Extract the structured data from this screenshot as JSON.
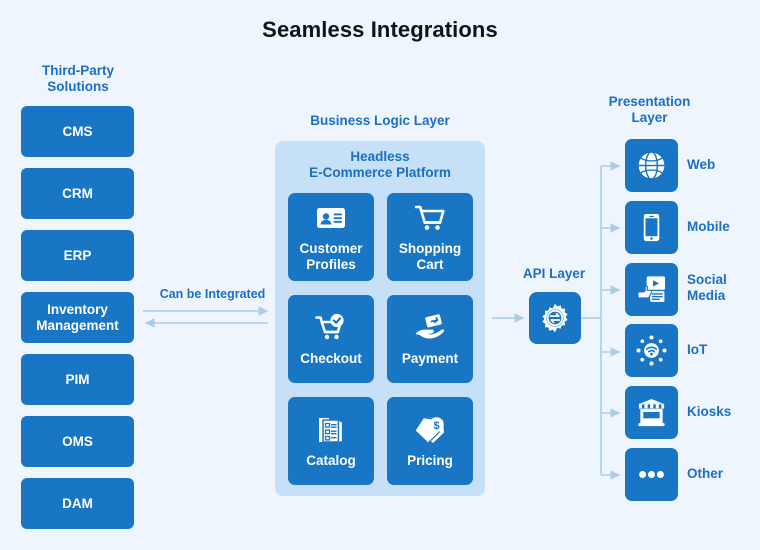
{
  "title": "Seamless Integrations",
  "colors": {
    "background": "#eff5fd",
    "box_blue": "#1976c4",
    "container_blue": "#c6e0f7",
    "heading_blue": "#1b6fc4",
    "connector_blue": "#aacdea",
    "title_dark": "#0f1419"
  },
  "third_party": {
    "heading": "Third-Party\nSolutions",
    "heading_line1": "Third-Party",
    "heading_line2": "Solutions",
    "items": [
      {
        "label": "CMS",
        "icon": "none"
      },
      {
        "label": "CRM",
        "icon": "none"
      },
      {
        "label": "ERP",
        "icon": "none"
      },
      {
        "label": "Inventory Management",
        "label_line1": "Inventory",
        "label_line2": "Management",
        "icon": "none"
      },
      {
        "label": "PIM",
        "icon": "none"
      },
      {
        "label": "OMS",
        "icon": "none"
      },
      {
        "label": "DAM",
        "icon": "none"
      }
    ]
  },
  "integration_connector": {
    "label": "Can be Integrated",
    "arrow_right": "arrow-right-icon",
    "arrow_left": "arrow-left-icon"
  },
  "business_logic": {
    "heading": "Business Logic Layer",
    "subtitle_line1": "Headless",
    "subtitle_line2": "E-Commerce Platform",
    "capabilities": [
      {
        "label": "Customer Profiles",
        "label_line1": "Customer",
        "label_line2": "Profiles",
        "icon": "id-card-icon"
      },
      {
        "label": "Shopping Cart",
        "label_line1": "Shopping",
        "label_line2": "Cart",
        "icon": "shopping-cart-icon"
      },
      {
        "label": "Checkout",
        "label_line1": "Checkout",
        "label_line2": "",
        "icon": "cart-check-icon"
      },
      {
        "label": "Payment",
        "label_line1": "Payment",
        "label_line2": "",
        "icon": "hand-card-icon"
      },
      {
        "label": "Catalog",
        "label_line1": "Catalog",
        "label_line2": "",
        "icon": "catalog-book-icon"
      },
      {
        "label": "Pricing",
        "label_line1": "Pricing",
        "label_line2": "",
        "icon": "price-tag-icon"
      }
    ]
  },
  "api_layer": {
    "label": "API Layer",
    "icon": "gear-exchange-icon"
  },
  "presentation": {
    "heading_line1": "Presentation",
    "heading_line2": "Layer",
    "channels": [
      {
        "label": "Web",
        "label_line1": "Web",
        "label_line2": "",
        "icon": "globe-icon"
      },
      {
        "label": "Mobile",
        "label_line1": "Mobile",
        "label_line2": "",
        "icon": "mobile-phone-icon"
      },
      {
        "label": "Social Media",
        "label_line1": "Social",
        "label_line2": "Media",
        "icon": "social-media-icon"
      },
      {
        "label": "IoT",
        "label_line1": "IoT",
        "label_line2": "",
        "icon": "iot-icon"
      },
      {
        "label": "Kiosks",
        "label_line1": "Kiosks",
        "label_line2": "",
        "icon": "kiosk-icon"
      },
      {
        "label": "Other",
        "label_line1": "Other",
        "label_line2": "",
        "icon": "ellipsis-icon"
      }
    ]
  }
}
